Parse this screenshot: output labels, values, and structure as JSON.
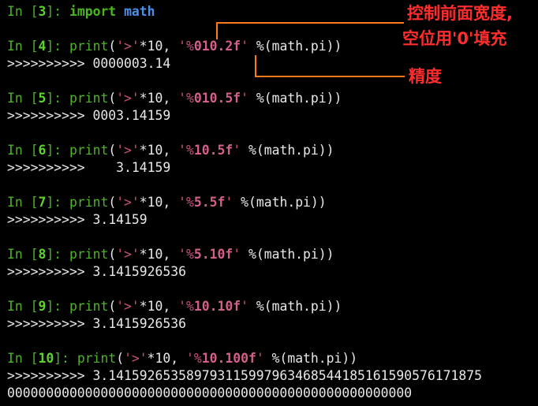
{
  "annotations": {
    "width_note_line1": "控制前面宽度,",
    "width_note_line2": "空位用'0'填充",
    "precision_note": "精度"
  },
  "cells": [
    {
      "prompt": "In [",
      "num": "3",
      "close": "]: ",
      "kw": "import",
      "sp": " ",
      "mod": "math"
    },
    {
      "prompt": "In [",
      "num": "4",
      "close": "]: ",
      "fn": "print",
      "p1": "(",
      "str1": "'>'",
      "mid": "*10, ",
      "str2a": "'%",
      "str2b": "010.2f",
      "str2c": "'",
      "rest": " %(math.pi))",
      "out": ">>>>>>>>>> 0000003.14"
    },
    {
      "prompt": "In [",
      "num": "5",
      "close": "]: ",
      "fn": "print",
      "p1": "(",
      "str1": "'>'",
      "mid": "*10, ",
      "str2a": "'%",
      "str2b": "010.5f",
      "str2c": "'",
      "rest": " %(math.pi))",
      "out": ">>>>>>>>>> 0003.14159"
    },
    {
      "prompt": "In [",
      "num": "6",
      "close": "]: ",
      "fn": "print",
      "p1": "(",
      "str1": "'>'",
      "mid": "*10, ",
      "str2a": "'%",
      "str2b": "10.5f",
      "str2c": "'",
      "rest": " %(math.pi))",
      "out": ">>>>>>>>>>    3.14159"
    },
    {
      "prompt": "In [",
      "num": "7",
      "close": "]: ",
      "fn": "print",
      "p1": "(",
      "str1": "'>'",
      "mid": "*10, ",
      "str2a": "'%",
      "str2b": "5.5f",
      "str2c": "'",
      "rest": " %(math.pi))",
      "out": ">>>>>>>>>> 3.14159"
    },
    {
      "prompt": "In [",
      "num": "8",
      "close": "]: ",
      "fn": "print",
      "p1": "(",
      "str1": "'>'",
      "mid": "*10, ",
      "str2a": "'%",
      "str2b": "5.10f",
      "str2c": "'",
      "rest": " %(math.pi))",
      "out": ">>>>>>>>>> 3.1415926536"
    },
    {
      "prompt": "In [",
      "num": "9",
      "close": "]: ",
      "fn": "print",
      "p1": "(",
      "str1": "'>'",
      "mid": "*10, ",
      "str2a": "'%",
      "str2b": "10.10f",
      "str2c": "'",
      "rest": " %(math.pi))",
      "out": ">>>>>>>>>> 3.1415926536"
    },
    {
      "prompt": "In [",
      "num": "10",
      "close": "]: ",
      "fn": "print",
      "p1": "(",
      "str1": "'>'",
      "mid": "*10, ",
      "str2a": "'%",
      "str2b": "10.100f",
      "str2c": "'",
      "rest": " %(math.pi))",
      "out": ">>>>>>>>>> 3.141592653589793115997963468544185161590576171875",
      "out2": "0000000000000000000000000000000000000000000000000000"
    }
  ],
  "colors": {
    "prompt": "#4cb520",
    "string": "#c8507e",
    "module": "#4f8fe8",
    "annotation_text": "#ff2d2d",
    "annotation_line": "#ff7a1a"
  }
}
